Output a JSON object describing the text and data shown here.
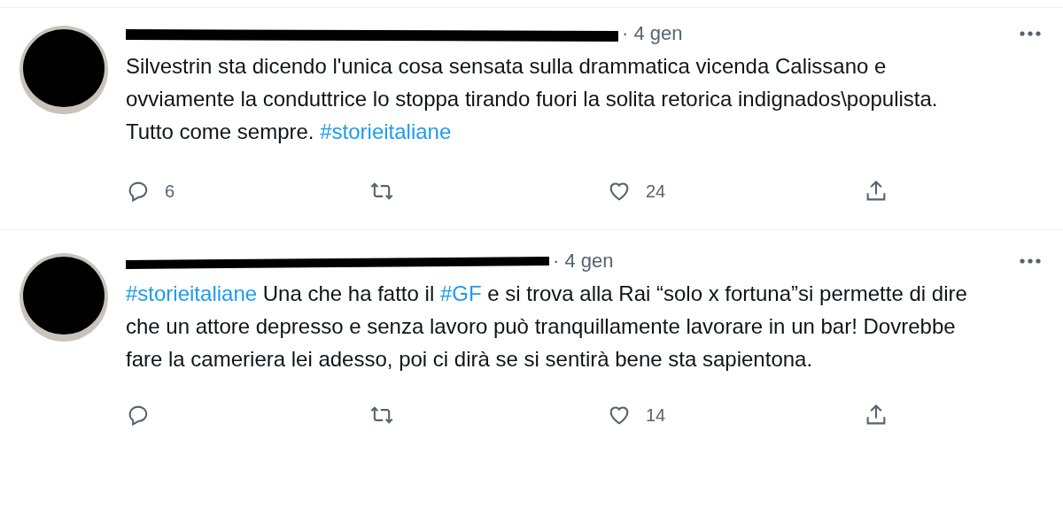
{
  "tweets": [
    {
      "time": "· 4 gen",
      "body": [
        {
          "kind": "text",
          "text": "Silvestrin sta dicendo l'unica cosa sensata sulla drammatica vicenda Calissano e ovviamente la conduttrice lo stoppa tirando fuori la solita retorica indignados\\populista. Tutto come sempre. "
        },
        {
          "kind": "hashtag",
          "text": "#storieitaliane"
        }
      ],
      "replies": "6",
      "likes": "24"
    },
    {
      "time": "· 4 gen",
      "body": [
        {
          "kind": "hashtag",
          "text": "#storieitaliane"
        },
        {
          "kind": "text",
          "text": " Una che ha fatto il "
        },
        {
          "kind": "hashtag",
          "text": "#GF"
        },
        {
          "kind": "text",
          "text": " e si trova alla Rai “solo x fortuna”si permette di dire che un attore depresso e senza lavoro può tranquillamente lavorare in un bar! Dovrebbe fare la cameriera lei adesso, poi ci dirà se si sentirà bene sta sapientona."
        }
      ],
      "likes": "14"
    }
  ]
}
